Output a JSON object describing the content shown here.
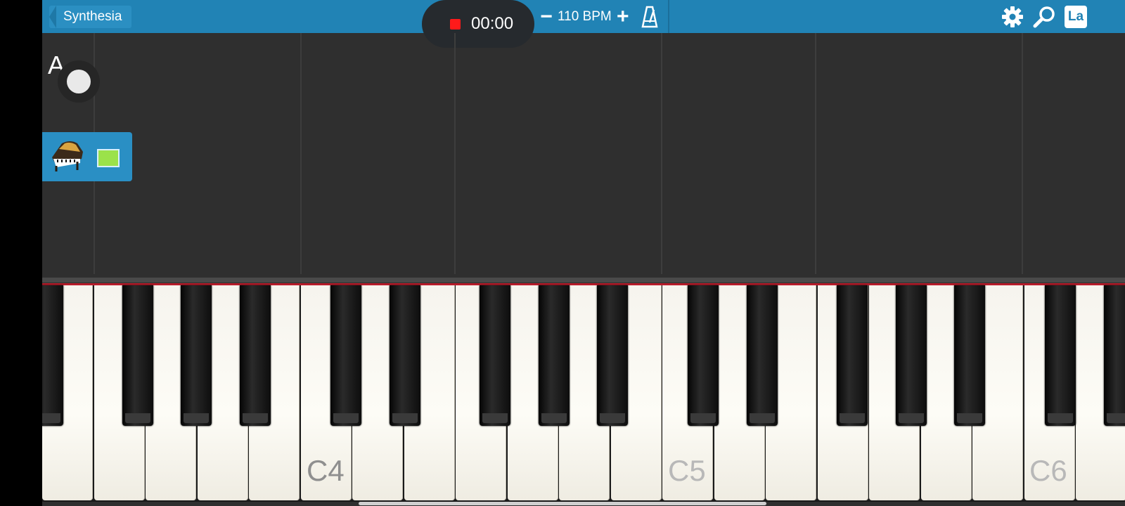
{
  "header": {
    "back_label": "Synthesia",
    "record_time": "00:00",
    "tempo_label": "110 BPM",
    "minus_glyph": "−",
    "plus_glyph": "+",
    "la_label": "La",
    "icons": [
      "record-icon",
      "metronome-icon",
      "gear-icon",
      "search-icon",
      "la-icon"
    ]
  },
  "track": {
    "label": "A",
    "instrument": "piano-icon",
    "color": "#9be24a"
  },
  "keyboard": {
    "note_labels": [
      "C4",
      "C5",
      "C6"
    ]
  },
  "colors": {
    "topbar": "#2183b5",
    "timeline": "#2f2f2f",
    "record": "#ff1a1a",
    "keyline": "#b71c2b"
  }
}
